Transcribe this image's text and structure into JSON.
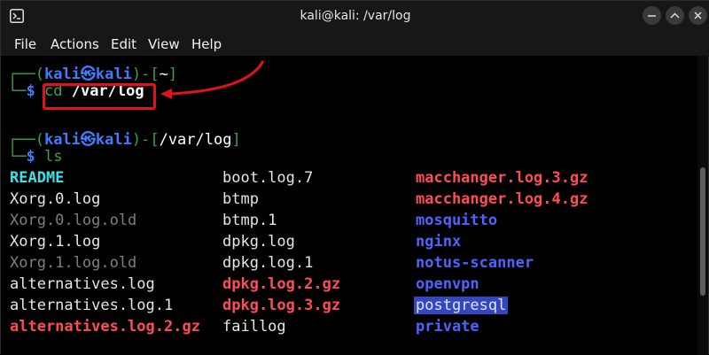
{
  "window": {
    "title": "kali@kali: /var/log"
  },
  "menu": [
    "File",
    "Actions",
    "Edit",
    "View",
    "Help"
  ],
  "prompt1": {
    "user": "kali",
    "sep": "㉿",
    "host": "kali",
    "dir": "~",
    "symbol": "$",
    "cmd": "cd",
    "arg": "/var/log"
  },
  "prompt2": {
    "user": "kali",
    "sep": "㉿",
    "host": "kali",
    "dir": "/var/log",
    "symbol": "$",
    "cmd": "ls"
  },
  "files": [
    [
      "README",
      "boot.log.7",
      "macchanger.log.3.gz"
    ],
    [
      "Xorg.0.log",
      "btmp",
      "macchanger.log.4.gz"
    ],
    [
      "Xorg.0.log.old",
      "btmp.1",
      "mosquitto"
    ],
    [
      "Xorg.1.log",
      "dpkg.log",
      "nginx"
    ],
    [
      "Xorg.1.log.old",
      "dpkg.log.1",
      "notus-scanner"
    ],
    [
      "alternatives.log",
      "dpkg.log.2.gz",
      "openvpn"
    ],
    [
      "alternatives.log.1",
      "dpkg.log.3.gz",
      "postgresql"
    ],
    [
      "alternatives.log.2.gz",
      "faillog",
      "private"
    ]
  ],
  "colors": {
    "highlight_box": "#e0131c",
    "prompt": "#37a34a",
    "dir": "#3d7cff"
  }
}
